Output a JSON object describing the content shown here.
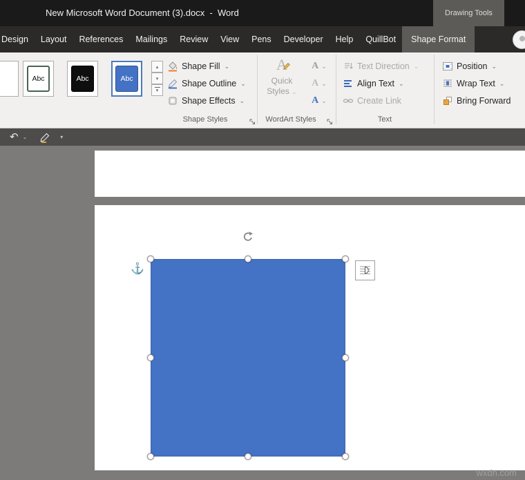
{
  "icons": {
    "chevron": "⌄",
    "dropdown": "▾",
    "up": "▴",
    "down": "▾",
    "undo": "↶",
    "anchor": "⚓"
  },
  "title_bar": {
    "title": "New Microsoft Word Document (3).docx  -  Word",
    "contextual_label": "Drawing Tools"
  },
  "tabs": {
    "items": [
      "Design",
      "Layout",
      "References",
      "Mailings",
      "Review",
      "View",
      "Pens",
      "Developer",
      "Help",
      "QuillBot"
    ],
    "active": "Shape Format"
  },
  "ribbon": {
    "shape_styles": {
      "group_label": "Shape Styles",
      "thumb_label": "Abc",
      "shape_fill": "Shape Fill",
      "shape_outline": "Shape Outline",
      "shape_effects": "Shape Effects"
    },
    "wordart": {
      "group_label": "WordArt Styles",
      "quick_styles_line1": "Quick",
      "quick_styles_line2": "Styles",
      "letter": "A"
    },
    "text_group": {
      "group_label": "Text",
      "text_direction": "Text Direction",
      "align_text": "Align Text",
      "create_link": "Create Link"
    },
    "arrange": {
      "position": "Position",
      "wrap_text": "Wrap Text",
      "bring_forward": "Bring Forward"
    }
  },
  "document": {
    "watermark": "wxdn.com"
  },
  "colors": {
    "accent_blue": "#4472c4",
    "fill_orange": "#ed7d31",
    "titlebar": "#1a1a1a",
    "contextual_tab_bg": "#5d5b58"
  }
}
